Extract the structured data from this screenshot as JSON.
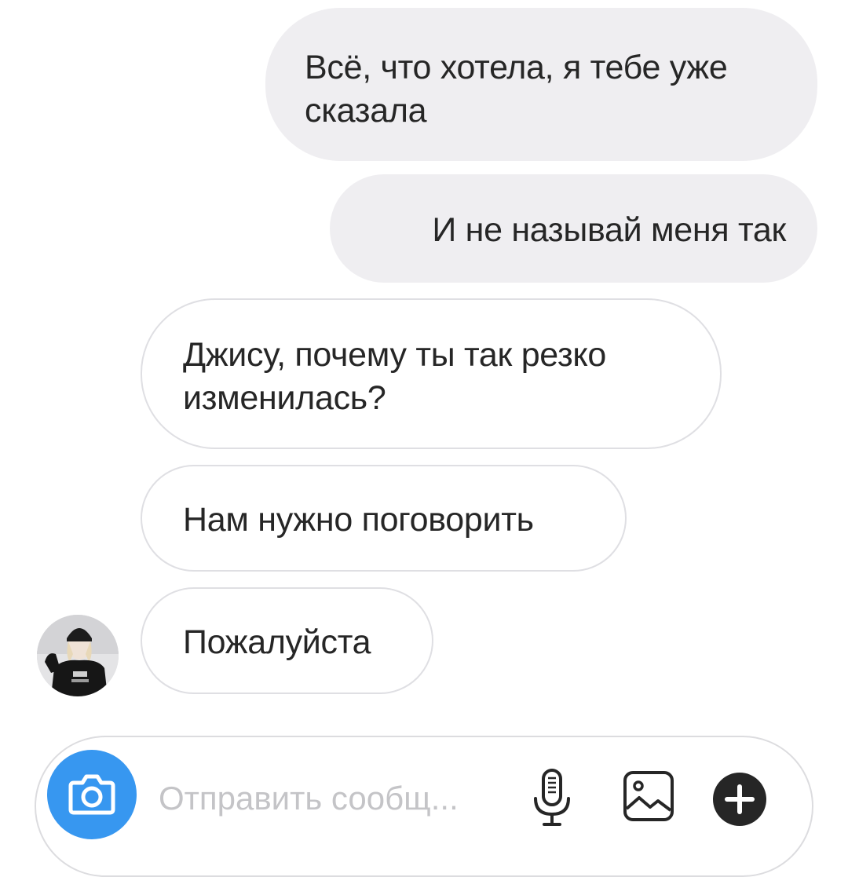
{
  "thread": {
    "messages": [
      {
        "direction": "outgoing",
        "text": "Всё, что хотела, я тебе уже сказала"
      },
      {
        "direction": "outgoing",
        "text": "И не называй меня так"
      },
      {
        "direction": "incoming",
        "text": "Джису, почему ты так резко изменилась?"
      },
      {
        "direction": "incoming",
        "text": "Нам нужно поговорить"
      },
      {
        "direction": "incoming",
        "text": "Пожалуйста"
      }
    ]
  },
  "composer": {
    "placeholder": "Отправить сообщ...",
    "icons": {
      "camera": "camera-icon",
      "mic": "microphone-icon",
      "gallery": "image-icon",
      "add": "plus-icon"
    }
  },
  "colors": {
    "outgoing_bubble": "#efeef1",
    "incoming_border": "#dfdfe3",
    "camera_button": "#3797f0",
    "text": "#262626",
    "placeholder": "#c4c4c7"
  }
}
